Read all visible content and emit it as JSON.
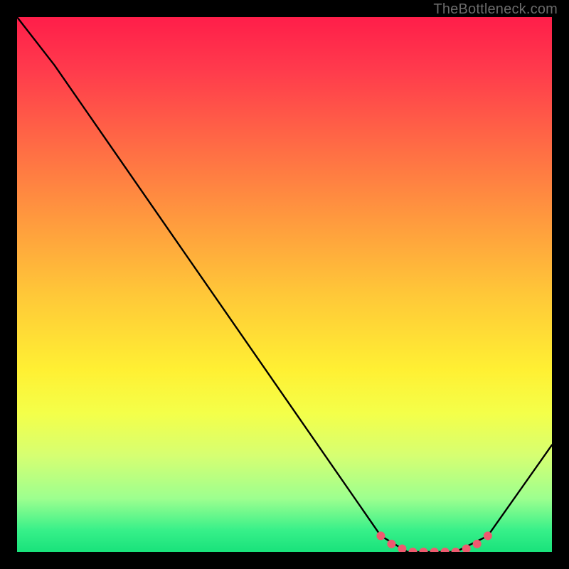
{
  "watermark": "TheBottleneck.com",
  "colors": {
    "page_bg": "#000000",
    "curve": "#000000",
    "marker": "#ef5a6f",
    "gradient_top": "#ff1e4a",
    "gradient_bottom": "#19e27b"
  },
  "chart_data": {
    "type": "line",
    "title": "",
    "xlabel": "",
    "ylabel": "",
    "xlim": [
      0,
      100
    ],
    "ylim": [
      0,
      100
    ],
    "series": [
      {
        "name": "curve",
        "x": [
          0,
          7,
          68,
          73,
          82,
          88,
          100
        ],
        "y": [
          100,
          91,
          3,
          0,
          0,
          3,
          20
        ]
      }
    ],
    "markers": {
      "name": "highlight-points",
      "x": [
        68,
        70,
        72,
        74,
        76,
        78,
        80,
        82,
        84,
        86,
        88
      ],
      "y": [
        3,
        1.5,
        0.6,
        0,
        0,
        0,
        0,
        0,
        0.6,
        1.5,
        3
      ]
    }
  }
}
